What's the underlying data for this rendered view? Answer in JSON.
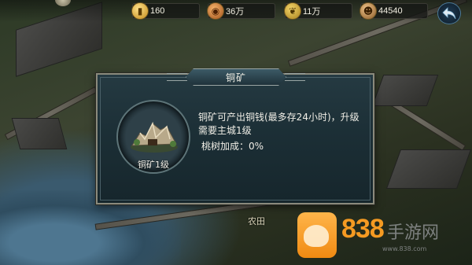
{
  "resources": [
    {
      "icon": "gold-ingot-icon",
      "value": "160"
    },
    {
      "icon": "copper-coin-icon",
      "value": "36万"
    },
    {
      "icon": "grain-icon",
      "value": "11万"
    },
    {
      "icon": "troops-icon",
      "value": "44540"
    }
  ],
  "map": {
    "farm_label": "农田"
  },
  "dialog": {
    "title": "铜矿",
    "level_label": "铜矿1级",
    "description": "铜矿可产出铜钱(最多存24小时)，升级需要主城1级",
    "bonus": "桃树加成：0%"
  },
  "watermark": {
    "number": "838",
    "site": "手游网",
    "url": "www.838.com"
  },
  "colors": {
    "dialog_bg": "#1c2f36",
    "frame": "#8a8a7c",
    "watermark_orange": "#f59a22"
  }
}
